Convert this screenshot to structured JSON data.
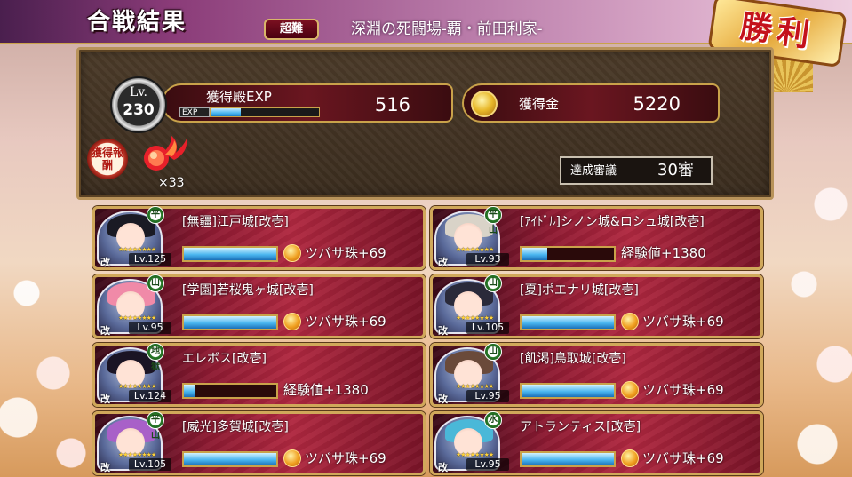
{
  "header": {
    "title": "合戦結果",
    "difficulty": "超難",
    "stage": "深淵の死闘場-覇・前田利家-",
    "result": "勝利"
  },
  "summary": {
    "lv_label": "Lv.",
    "level": "230",
    "exp_label": "獲得殿EXP",
    "exp_bar_label": "EXP",
    "exp_progress": 0.28,
    "exp_value": "516",
    "gold_label": "獲得金",
    "gold_value": "5220",
    "reward_seal": "獲得報酬",
    "reward_count": "×33",
    "achievement_label": "達成審議",
    "achievement_value": "30審"
  },
  "cards": [
    {
      "name": "[無疆]江戸城[改壱]",
      "level": "Lv.125",
      "terrain": "平",
      "progress": 1.0,
      "reward": "ツバサ珠+69",
      "reward_icon": "tsubasa-orb-icon",
      "colors": {
        "hair": "#1a1a24"
      }
    },
    {
      "name": "[ｱｲﾄﾞﾙ]シノン城&ロシュ城[改壱]",
      "level": "Lv.93",
      "terrain": "平山",
      "progress": 0.28,
      "reward": "経験値+1380",
      "reward_icon": "",
      "colors": {
        "hair": "#d9d3c8"
      }
    },
    {
      "name": "[学園]若桜鬼ヶ城[改壱]",
      "level": "Lv.95",
      "terrain": "山",
      "progress": 1.0,
      "reward": "ツバサ珠+69",
      "reward_icon": "tsubasa-orb-icon",
      "colors": {
        "hair": "#f08aa8"
      }
    },
    {
      "name": "[夏]ポエナリ城[改壱]",
      "level": "Lv.105",
      "terrain": "山",
      "progress": 1.0,
      "reward": "ツバサ珠+69",
      "reward_icon": "tsubasa-orb-icon",
      "colors": {
        "hair": "#2a2a3a"
      }
    },
    {
      "name": "エレボス[改壱]",
      "level": "Lv.124",
      "terrain": "地獄",
      "progress": 0.12,
      "reward": "経験値+1380",
      "reward_icon": "",
      "colors": {
        "hair": "#1a1424"
      }
    },
    {
      "name": "[飢渇]鳥取城[改壱]",
      "level": "Lv.95",
      "terrain": "山",
      "progress": 1.0,
      "reward": "ツバサ珠+69",
      "reward_icon": "tsubasa-orb-icon",
      "colors": {
        "hair": "#6a4a3a"
      }
    },
    {
      "name": "[威光]多賀城[改壱]",
      "level": "Lv.105",
      "terrain": "平山",
      "progress": 1.0,
      "reward": "ツバサ珠+69",
      "reward_icon": "tsubasa-orb-icon",
      "colors": {
        "hair": "#a860c8"
      }
    },
    {
      "name": "アトランティス[改壱]",
      "level": "Lv.95",
      "terrain": "水",
      "progress": 1.0,
      "reward": "ツバサ珠+69",
      "reward_icon": "tsubasa-orb-icon",
      "colors": {
        "hair": "#4ab8d8"
      }
    }
  ],
  "card_common": {
    "kai": "改",
    "stars": "★★★★★★★★"
  }
}
